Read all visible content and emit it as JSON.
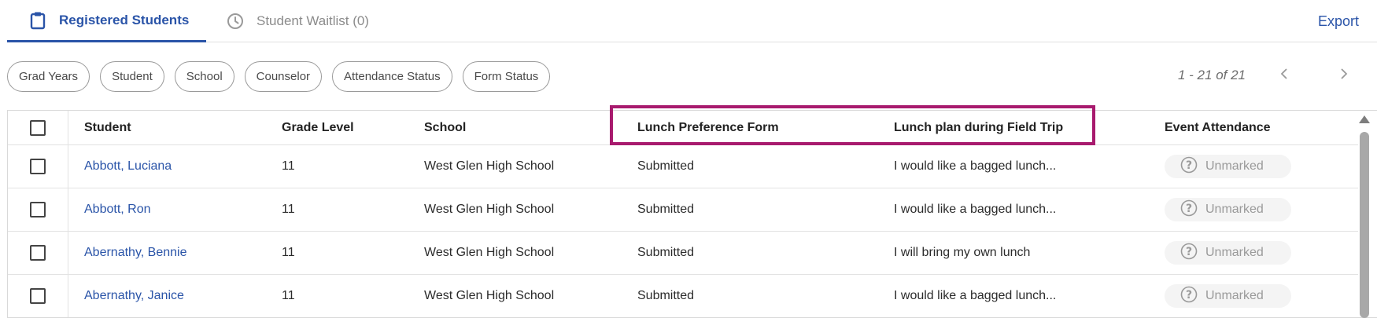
{
  "tabs": {
    "registered_label": "Registered Students",
    "waitlist_label": "Student Waitlist (0)"
  },
  "toolbar": {
    "export_label": "Export"
  },
  "filters": [
    "Grad Years",
    "Student",
    "School",
    "Counselor",
    "Attendance Status",
    "Form Status"
  ],
  "pagination": {
    "range_text": "1 - 21 of 21"
  },
  "table": {
    "headers": {
      "student": "Student",
      "grade": "Grade Level",
      "school": "School",
      "form": "Lunch Preference Form",
      "plan": "Lunch plan during Field Trip",
      "attendance": "Event Attendance"
    },
    "rows": [
      {
        "student": "Abbott, Luciana",
        "grade": "11",
        "school": "West Glen High School",
        "form": "Submitted",
        "plan": "I would like a bagged lunch...",
        "attendance": "Unmarked"
      },
      {
        "student": "Abbott, Ron",
        "grade": "11",
        "school": "West Glen High School",
        "form": "Submitted",
        "plan": "I would like a bagged lunch...",
        "attendance": "Unmarked"
      },
      {
        "student": "Abernathy, Bennie",
        "grade": "11",
        "school": "West Glen High School",
        "form": "Submitted",
        "plan": "I will bring my own lunch",
        "attendance": "Unmarked"
      },
      {
        "student": "Abernathy, Janice",
        "grade": "11",
        "school": "West Glen High School",
        "form": "Submitted",
        "plan": "I would like a bagged lunch...",
        "attendance": "Unmarked"
      }
    ]
  },
  "colors": {
    "accent": "#2a54a8",
    "highlight": "#a81a6e",
    "muted": "#8b8b8b"
  },
  "icons": {
    "registered_tab": "clipboard-icon",
    "waitlist_tab": "clock-icon",
    "attendance_badge": "question-circle-icon",
    "pager_prev": "chevron-left-icon",
    "pager_next": "chevron-right-icon"
  }
}
